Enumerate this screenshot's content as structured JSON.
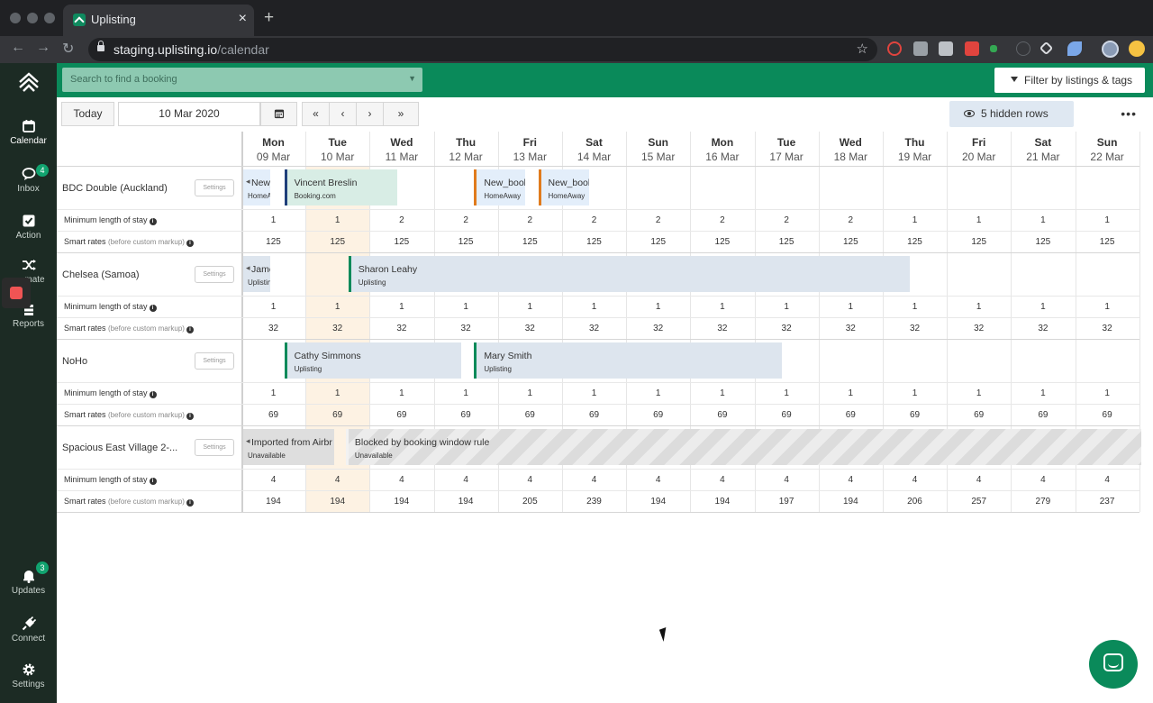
{
  "browser": {
    "tab_title": "Uplisting",
    "url_host": "staging.uplisting.io",
    "url_path": "/calendar"
  },
  "sidebar": {
    "items": [
      {
        "label": "Calendar",
        "icon": "calendar-icon"
      },
      {
        "label": "Inbox",
        "icon": "chat-icon",
        "badge": "4"
      },
      {
        "label": "Action",
        "icon": "checkbox-icon"
      },
      {
        "label": "mate",
        "icon": "shuffle-icon"
      },
      {
        "label": "Reports",
        "icon": "reports-icon"
      },
      {
        "label": "Updates",
        "icon": "bell-icon",
        "badge": "3"
      },
      {
        "label": "Connect",
        "icon": "plug-icon"
      },
      {
        "label": "Settings",
        "icon": "gear-icon"
      }
    ]
  },
  "header": {
    "search_placeholder": "Search to find a booking",
    "filter_label": "Filter by listings & tags"
  },
  "toolbar": {
    "today_label": "Today",
    "date_value": "10 Mar 2020",
    "nav": [
      "«",
      "‹",
      "›",
      "»"
    ],
    "hidden_rows_label": "5 hidden rows",
    "more_label": "•••"
  },
  "calendar": {
    "days": [
      {
        "dow": "Mon",
        "date": "09 Mar"
      },
      {
        "dow": "Tue",
        "date": "10 Mar"
      },
      {
        "dow": "Wed",
        "date": "11 Mar"
      },
      {
        "dow": "Thu",
        "date": "12 Mar"
      },
      {
        "dow": "Fri",
        "date": "13 Mar"
      },
      {
        "dow": "Sat",
        "date": "14 Mar"
      },
      {
        "dow": "Sun",
        "date": "15 Mar"
      },
      {
        "dow": "Mon",
        "date": "16 Mar"
      },
      {
        "dow": "Tue",
        "date": "17 Mar"
      },
      {
        "dow": "Wed",
        "date": "18 Mar"
      },
      {
        "dow": "Thu",
        "date": "19 Mar"
      },
      {
        "dow": "Fri",
        "date": "20 Mar"
      },
      {
        "dow": "Sat",
        "date": "21 Mar"
      },
      {
        "dow": "Sun",
        "date": "22 Mar"
      }
    ],
    "min_stay_label": "Minimum length of stay",
    "smart_rates_label": "Smart rates",
    "smart_rates_note": "(before custom markup)",
    "settings_label": "Settings",
    "listings": [
      {
        "name": "BDC Double (Auckland)",
        "min_stay": [
          "1",
          "1",
          "2",
          "2",
          "2",
          "2",
          "2",
          "2",
          "2",
          "2",
          "1",
          "1",
          "1",
          "1"
        ],
        "rates": [
          "125",
          "125",
          "125",
          "125",
          "125",
          "125",
          "125",
          "125",
          "125",
          "125",
          "125",
          "125",
          "125",
          "125"
        ],
        "bookings": [
          {
            "name": "New_",
            "source": "HomeA",
            "color": "#e3eefa",
            "border": "#e3eefa",
            "clip": true
          },
          {
            "name": "Vincent Breslin",
            "source": "Booking.com",
            "color": "#d8ede5",
            "border": "#1f3f7a"
          },
          {
            "name": "New_bool",
            "source": "HomeAway",
            "color": "#e3eefa",
            "border": "#e07b1d"
          },
          {
            "name": "New_bool",
            "source": "HomeAway",
            "color": "#e3eefa",
            "border": "#e07b1d"
          }
        ]
      },
      {
        "name": "Chelsea (Samoa)",
        "min_stay": [
          "1",
          "1",
          "1",
          "1",
          "1",
          "1",
          "1",
          "1",
          "1",
          "1",
          "1",
          "1",
          "1",
          "1"
        ],
        "rates": [
          "32",
          "32",
          "32",
          "32",
          "32",
          "32",
          "32",
          "32",
          "32",
          "32",
          "32",
          "32",
          "32",
          "32"
        ],
        "bookings": [
          {
            "name": "Jame",
            "source": "Uplistin",
            "color": "#dde5ee",
            "border": "#dde5ee",
            "clip": true
          },
          {
            "name": "Sharon Leahy",
            "source": "Uplisting",
            "color": "#dde5ee",
            "border": "#0a8a5a"
          }
        ]
      },
      {
        "name": "NoHo",
        "min_stay": [
          "1",
          "1",
          "1",
          "1",
          "1",
          "1",
          "1",
          "1",
          "1",
          "1",
          "1",
          "1",
          "1",
          "1"
        ],
        "rates": [
          "69",
          "69",
          "69",
          "69",
          "69",
          "69",
          "69",
          "69",
          "69",
          "69",
          "69",
          "69",
          "69",
          "69"
        ],
        "bookings": [
          {
            "name": "Cathy Simmons",
            "source": "Uplisting",
            "color": "#dde5ee",
            "border": "#0a8a5a"
          },
          {
            "name": "Mary Smith",
            "source": "Uplisting",
            "color": "#dde5ee",
            "border": "#0a8a5a"
          }
        ]
      },
      {
        "name": "Spacious East Village 2-...",
        "min_stay": [
          "4",
          "4",
          "4",
          "4",
          "4",
          "4",
          "4",
          "4",
          "4",
          "4",
          "4",
          "4",
          "4",
          "4"
        ],
        "rates": [
          "194",
          "194",
          "194",
          "194",
          "205",
          "239",
          "194",
          "194",
          "197",
          "194",
          "206",
          "257",
          "279",
          "237"
        ],
        "bookings": [
          {
            "name": "Imported from Airbr",
            "source": "Unavailable",
            "color": "#dedede",
            "border": "#dedede",
            "clip": true
          },
          {
            "name": "Blocked by booking window rule",
            "source": "Unavailable",
            "color": "striped",
            "border": "transparent"
          }
        ]
      }
    ]
  }
}
